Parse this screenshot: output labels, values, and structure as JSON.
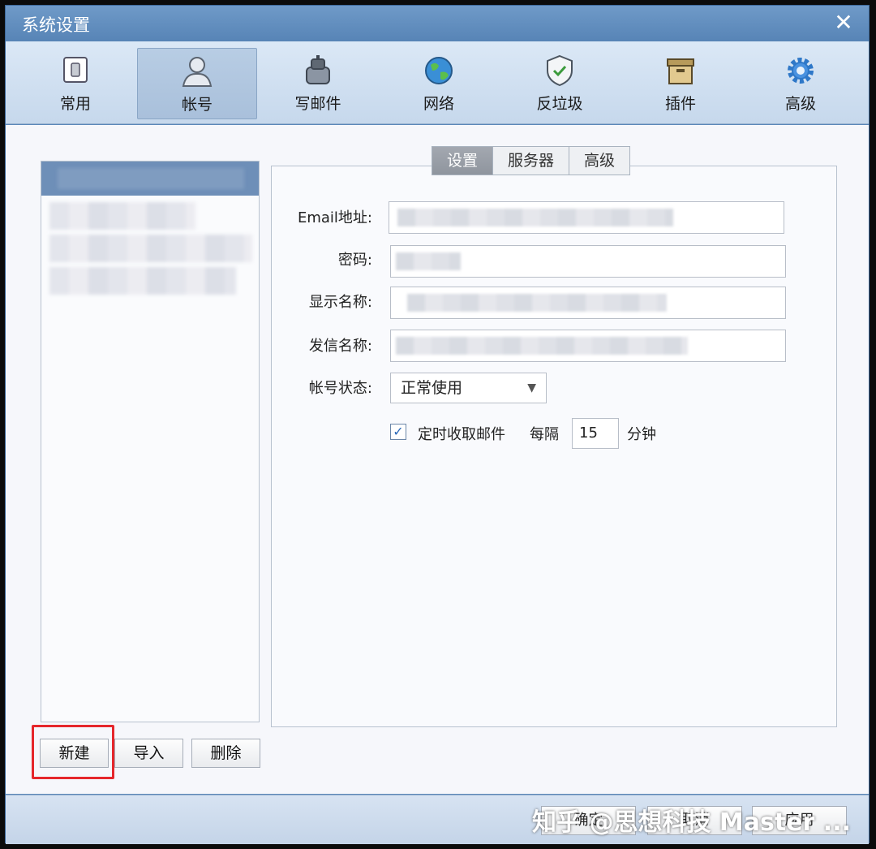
{
  "window": {
    "title": "系统设置",
    "close_glyph": "✕"
  },
  "toolbar": {
    "items": [
      {
        "label": "常用",
        "icon": "general-icon"
      },
      {
        "label": "帐号",
        "icon": "account-icon"
      },
      {
        "label": "写邮件",
        "icon": "compose-icon"
      },
      {
        "label": "网络",
        "icon": "network-globe-icon"
      },
      {
        "label": "反垃圾",
        "icon": "antispam-shield-icon"
      },
      {
        "label": "插件",
        "icon": "plugin-box-icon"
      },
      {
        "label": "高级",
        "icon": "advanced-gear-icon"
      }
    ],
    "active_index": 1
  },
  "tabs": {
    "items": [
      "设置",
      "服务器",
      "高级"
    ],
    "active_index": 0
  },
  "form": {
    "email_label": "Email地址:",
    "password_label": "密码:",
    "display_name_label": "显示名称:",
    "sender_name_label": "发信名称:",
    "status_label": "帐号状态:",
    "status_value": "正常使用",
    "auto_fetch_label": "定时收取邮件",
    "every_label": "每隔",
    "interval_value": "15",
    "unit_label": "分钟"
  },
  "list_actions": {
    "new": "新建",
    "import": "导入",
    "delete": "删除"
  },
  "footer": {
    "ok": "确定",
    "cancel": "取消",
    "apply": "应用",
    "watermark": "知乎 @思想科技 Master ..."
  },
  "colors": {
    "accent": "#5b87b8",
    "highlight": "#e5262b"
  }
}
